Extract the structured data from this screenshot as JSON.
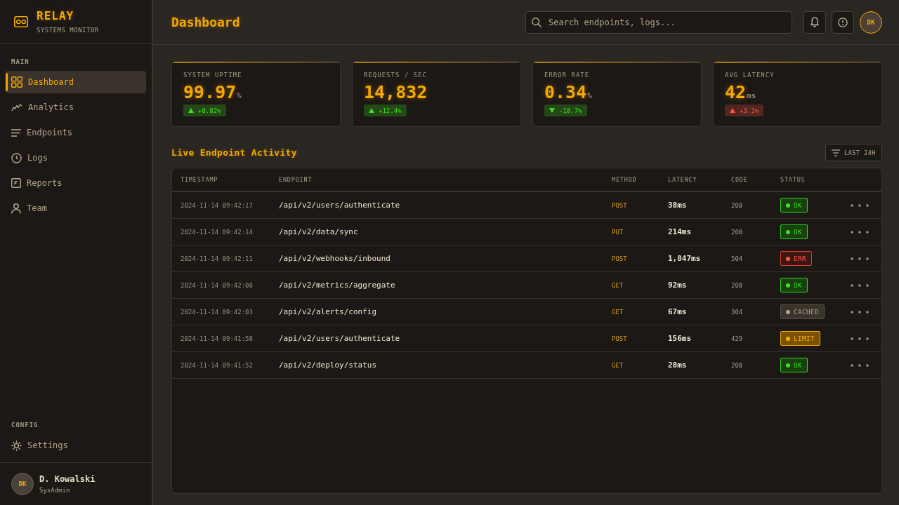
{
  "sidebar": {
    "brand": {
      "name": "RELAY",
      "subtitle": "SYSTEMS MONITOR"
    },
    "sections": [
      {
        "label": "MAIN",
        "items": [
          {
            "label": "Dashboard",
            "selected": true
          },
          {
            "label": "Analytics",
            "selected": false
          },
          {
            "label": "Endpoints",
            "selected": false
          },
          {
            "label": "Logs",
            "selected": false
          },
          {
            "label": "Reports",
            "selected": false
          },
          {
            "label": "Team",
            "selected": false
          }
        ]
      },
      {
        "label": "CONFIG",
        "items": [
          {
            "label": "Settings",
            "selected": false
          }
        ]
      }
    ],
    "user": {
      "initials": "DK",
      "name": "D. Kowalski",
      "role": "SysAdmin"
    }
  },
  "header": {
    "title": "Dashboard",
    "search": {
      "placeholder": "Search endpoints, logs..."
    },
    "avatar": "DK"
  },
  "stats": [
    {
      "label": "SYSTEM UPTIME",
      "value": "99.97",
      "unit": "%",
      "change": "+0.02%",
      "rising": true,
      "color": "#3ee01f"
    },
    {
      "label": "REQUESTS / SEC",
      "value": "14,832",
      "change": "+12.4%",
      "rising": true,
      "color": "#3ee01f"
    },
    {
      "label": "ERROR RATE",
      "value": "0.34",
      "unit": "%",
      "change": "-18.7%",
      "rising": false,
      "color": "#3ee01f"
    },
    {
      "label": "AVG LATENCY",
      "value": "42",
      "unit": "ms",
      "change": "+3.1%",
      "rising": true,
      "color": "#ff5544"
    }
  ],
  "activity": {
    "title": "Live Endpoint Activity",
    "filter": "LAST 24H",
    "table": {
      "columns": [
        "TIMESTAMP",
        "ENDPOINT",
        "METHOD",
        "LATENCY",
        "CODE",
        "STATUS"
      ],
      "rows": [
        {
          "timestamp": "2024-11-14 09:42:17",
          "endpoint": "/api/v2/users/authenticate",
          "method": "POST",
          "latency": "38ms",
          "code": "200",
          "status": {
            "label": "OK",
            "kind": "ok"
          }
        },
        {
          "timestamp": "2024-11-14 09:42:14",
          "endpoint": "/api/v2/data/sync",
          "method": "PUT",
          "latency": "214ms",
          "code": "200",
          "status": {
            "label": "OK",
            "kind": "ok"
          }
        },
        {
          "timestamp": "2024-11-14 09:42:11",
          "endpoint": "/api/v2/webhooks/inbound",
          "method": "POST",
          "latency": "1,847ms",
          "code": "504",
          "status": {
            "label": "ERR",
            "kind": "error"
          }
        },
        {
          "timestamp": "2024-11-14 09:42:08",
          "endpoint": "/api/v2/metrics/aggregate",
          "method": "GET",
          "latency": "92ms",
          "code": "200",
          "status": {
            "label": "OK",
            "kind": "ok"
          }
        },
        {
          "timestamp": "2024-11-14 09:42:03",
          "endpoint": "/api/v2/alerts/config",
          "method": "GET",
          "latency": "67ms",
          "code": "304",
          "status": {
            "label": "CACHED",
            "kind": "cached"
          }
        },
        {
          "timestamp": "2024-11-14 09:41:58",
          "endpoint": "/api/v2/users/authenticate",
          "method": "POST",
          "latency": "156ms",
          "code": "429",
          "status": {
            "label": "LIMIT",
            "kind": "limit"
          }
        },
        {
          "timestamp": "2024-11-14 09:41:52",
          "endpoint": "/api/v2/deploy/status",
          "method": "GET",
          "latency": "28ms",
          "code": "200",
          "status": {
            "label": "OK",
            "kind": "ok"
          }
        }
      ]
    }
  }
}
